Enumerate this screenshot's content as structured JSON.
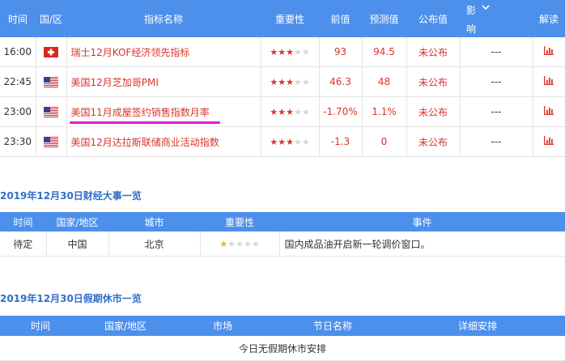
{
  "indicators": {
    "headers": {
      "time": "时间",
      "region": "国/区",
      "name": "指标名称",
      "importance": "重要性",
      "previous": "前值",
      "forecast": "预测值",
      "actual": "公布值",
      "impact_line1": "影",
      "impact_line2": "响",
      "analysis": "解读"
    },
    "rows": [
      {
        "time": "16:00",
        "flag": "switzerland",
        "name": "瑞士12月KOF经济领先指标",
        "stars": 3,
        "previous": "93",
        "forecast": "94.5",
        "actual": "未公布",
        "impact": "---"
      },
      {
        "time": "22:45",
        "flag": "usa",
        "name": "美国12月芝加哥PMI",
        "stars": 3,
        "previous": "46.3",
        "forecast": "48",
        "actual": "未公布",
        "impact": "---"
      },
      {
        "time": "23:00",
        "flag": "usa",
        "name": "美国11月成屋签约销售指数月率",
        "stars": 3,
        "previous": "-1.70%",
        "forecast": "1.1%",
        "actual": "未公布",
        "impact": "---"
      },
      {
        "time": "23:30",
        "flag": "usa",
        "name": "美国12月达拉斯联储商业活动指数",
        "stars": 3,
        "previous": "-1.3",
        "forecast": "0",
        "actual": "未公布",
        "impact": "---"
      }
    ]
  },
  "events": {
    "title": "2019年12月30日财经大事一览",
    "headers": {
      "time": "时间",
      "region": "国家/地区",
      "city": "城市",
      "importance": "重要性",
      "event": "事件"
    },
    "rows": [
      {
        "time": "待定",
        "region": "中国",
        "city": "北京",
        "stars": 1,
        "event": "国内成品油开启新一轮调价窗口。"
      }
    ]
  },
  "holidays": {
    "title": "2019年12月30日假期休市一览",
    "headers": {
      "time": "时间",
      "region": "国家/地区",
      "market": "市场",
      "holiday": "节日名称",
      "details": "详细安排"
    },
    "empty_text": "今日无假期休市安排"
  },
  "colors": {
    "header_bg": "#4d90ec",
    "accent_red": "#d9342b",
    "title_blue": "#2f6fc7",
    "highlight": "#e020d0"
  }
}
